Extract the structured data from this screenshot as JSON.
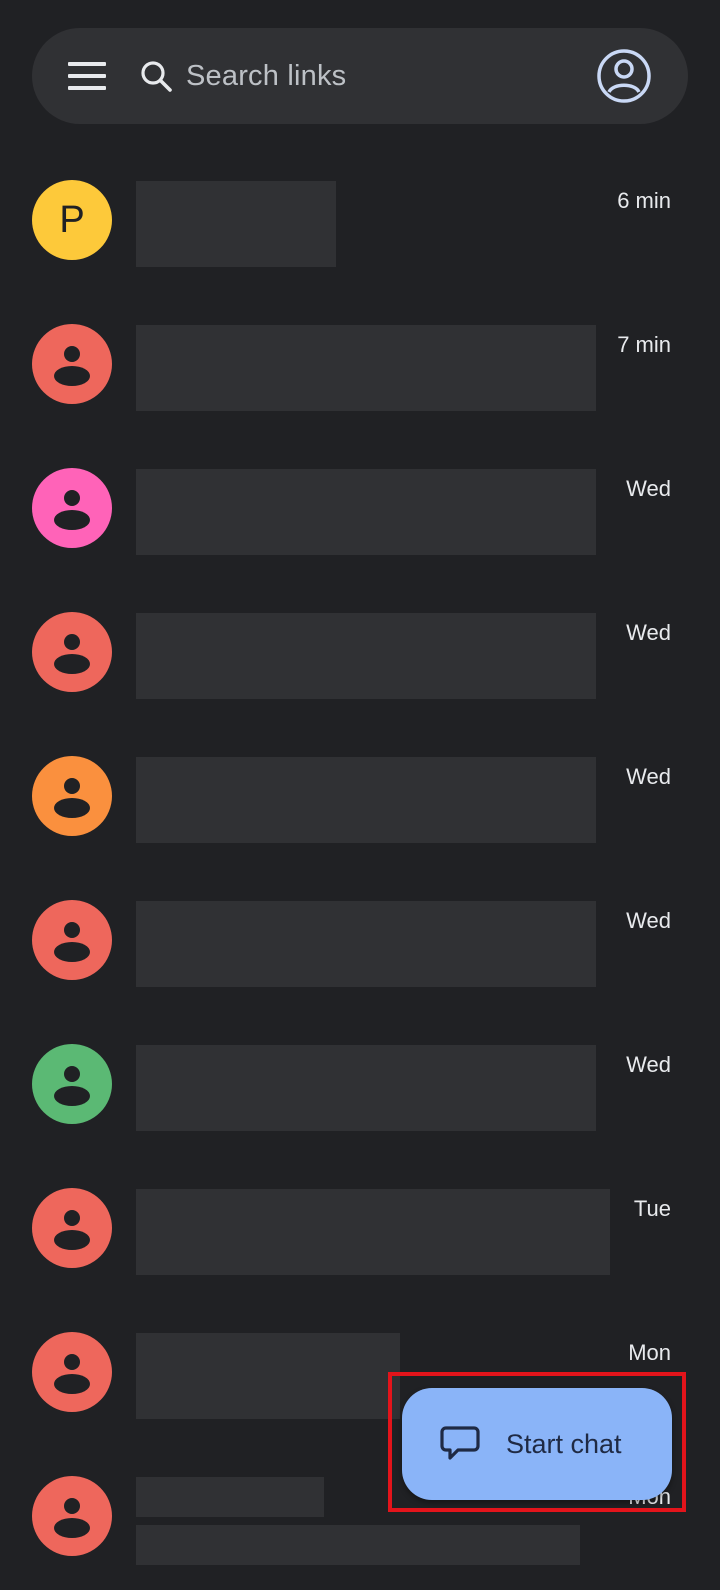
{
  "search": {
    "placeholder": "Search links",
    "menu_icon": "menu-icon",
    "search_icon": "search-icon",
    "account_icon": "account-icon"
  },
  "conversations": [
    {
      "avatar": "P",
      "avatar_color": "#fdc93a",
      "time": "6 min"
    },
    {
      "avatar": "person",
      "avatar_color": "#ee675c",
      "time": "7 min"
    },
    {
      "avatar": "person",
      "avatar_color": "#ff63b8",
      "time": "Wed"
    },
    {
      "avatar": "person",
      "avatar_color": "#ee675c",
      "time": "Wed"
    },
    {
      "avatar": "person",
      "avatar_color": "#fa903e",
      "time": "Wed"
    },
    {
      "avatar": "person",
      "avatar_color": "#ee675c",
      "time": "Wed"
    },
    {
      "avatar": "person",
      "avatar_color": "#5bb974",
      "time": "Wed"
    },
    {
      "avatar": "person",
      "avatar_color": "#ee675c",
      "time": "Tue"
    },
    {
      "avatar": "person",
      "avatar_color": "#ee675c",
      "time": "Mon"
    },
    {
      "avatar": "person",
      "avatar_color": "#ee675c",
      "time": "Mon"
    }
  ],
  "fab": {
    "label": "Start chat",
    "icon": "chat-bubble-icon",
    "color": "#8ab4f8"
  },
  "colors": {
    "background": "#202124",
    "surface": "#303134",
    "highlight": "#e3141b"
  }
}
